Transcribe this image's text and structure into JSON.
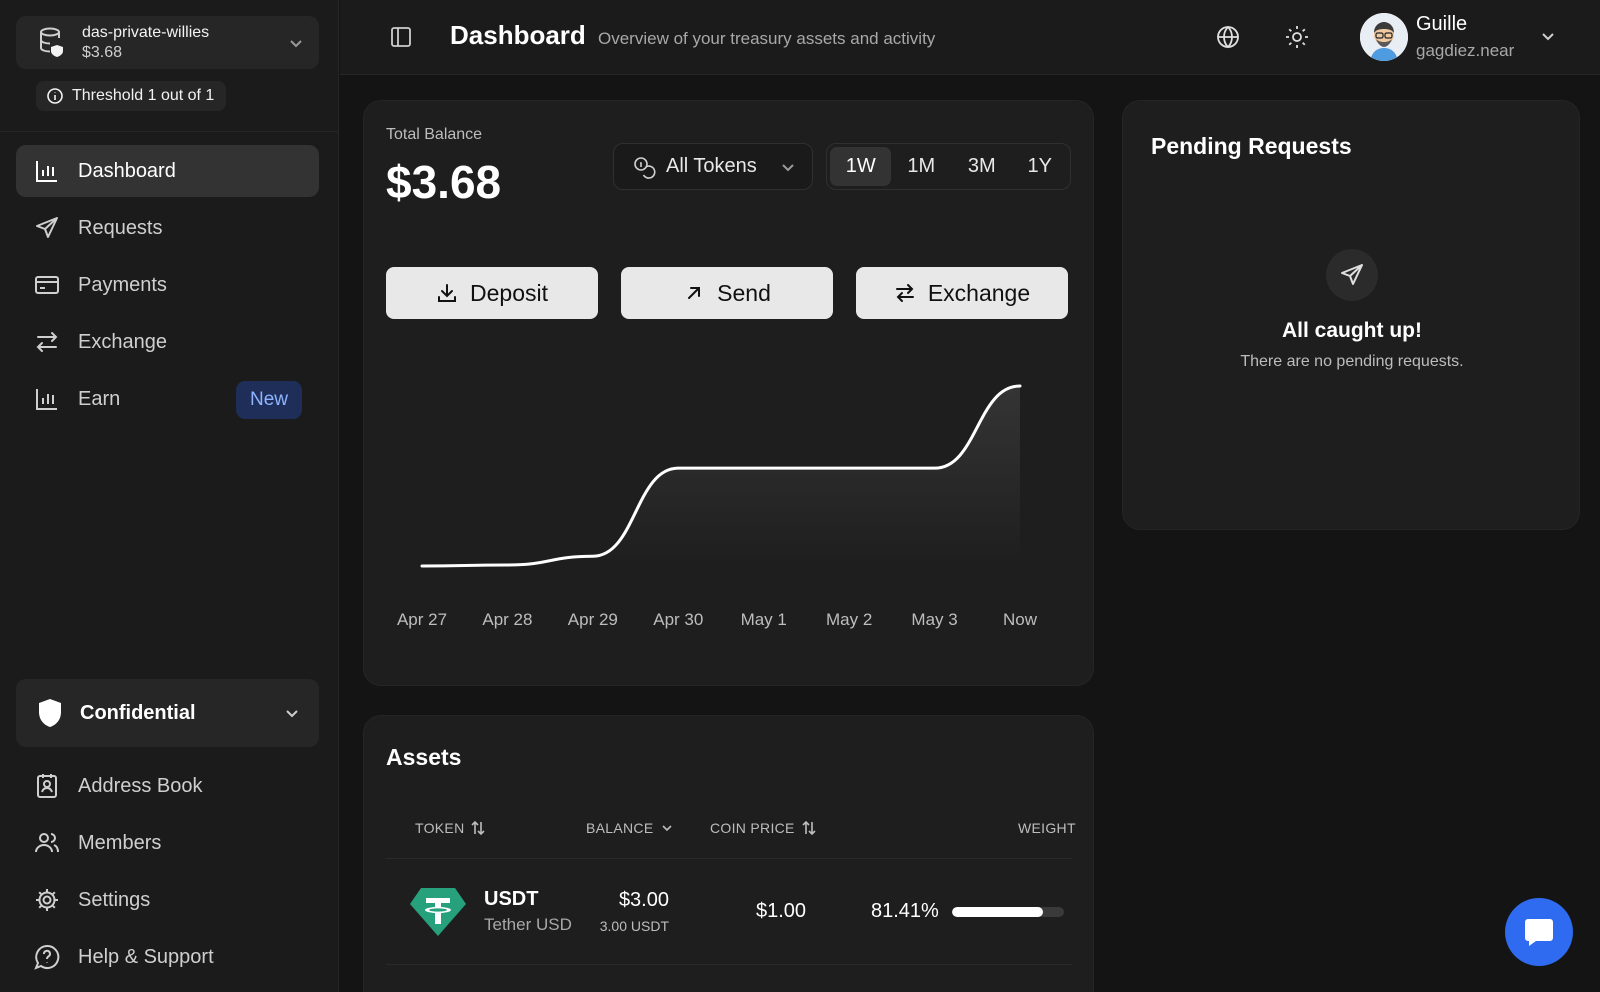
{
  "treasury": {
    "name": "das-private-willies",
    "balance": "$3.68"
  },
  "threshold": "Threshold 1 out of 1",
  "nav": {
    "dashboard": "Dashboard",
    "requests": "Requests",
    "payments": "Payments",
    "exchange": "Exchange",
    "earn": "Earn",
    "earn_badge": "New",
    "confidential": "Confidential",
    "address_book": "Address Book",
    "members": "Members",
    "settings": "Settings",
    "help": "Help & Support"
  },
  "header": {
    "title": "Dashboard",
    "subtitle": "Overview of your treasury assets and activity",
    "user_name": "Guille",
    "user_handle": "gagdiez.near"
  },
  "balance": {
    "label": "Total Balance",
    "value": "$3.68",
    "token_filter": "All Tokens",
    "ranges": [
      "1W",
      "1M",
      "3M",
      "1Y"
    ],
    "active_range": "1W",
    "actions": {
      "deposit": "Deposit",
      "send": "Send",
      "exchange": "Exchange"
    }
  },
  "chart_data": {
    "type": "line",
    "categories": [
      "Apr 27",
      "Apr 28",
      "Apr 29",
      "Apr 30",
      "May 1",
      "May 2",
      "May 3",
      "Now"
    ],
    "values": [
      0.0,
      0.02,
      0.2,
      2.0,
      2.0,
      2.0,
      2.0,
      3.68
    ],
    "ylim": [
      0,
      3.68
    ],
    "color": "#ffffff",
    "grid": false
  },
  "pending": {
    "title": "Pending Requests",
    "empty_title": "All caught up!",
    "empty_text": "There are no pending requests."
  },
  "assets": {
    "title": "Assets",
    "columns": {
      "token": "TOKEN",
      "balance": "BALANCE",
      "price": "COIN PRICE",
      "weight": "WEIGHT"
    },
    "rows": [
      {
        "symbol": "USDT",
        "name": "Tether USD",
        "balance": "$3.00",
        "balance_sub": "3.00 USDT",
        "price": "$1.00",
        "weight": "81.41%",
        "weight_fraction": 0.8141
      }
    ]
  },
  "colors": {
    "accent": "#2f6bf0",
    "usdt": "#26a17b",
    "badge_bg": "#1e2e58",
    "badge_text": "#8fb4ff"
  }
}
